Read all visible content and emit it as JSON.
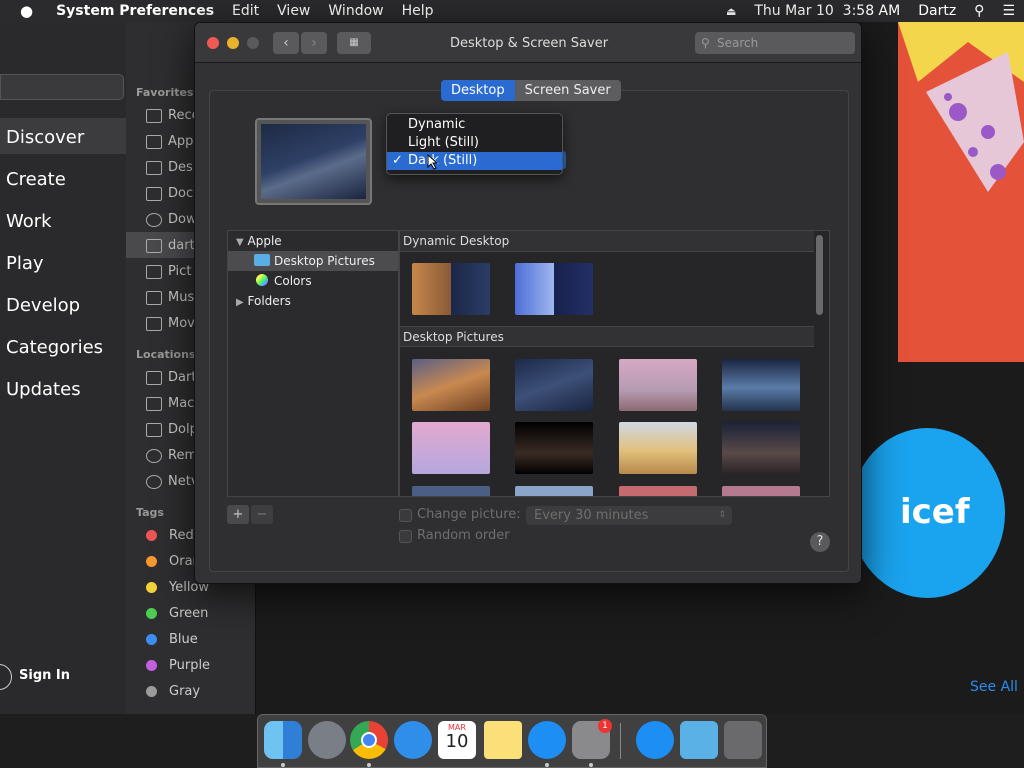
{
  "menubar": {
    "apple": "",
    "app_name": "System Preferences",
    "menus": [
      "Edit",
      "View",
      "Window",
      "Help"
    ],
    "clock": "Thu Mar 10  3:58 AM",
    "user": "Dartz"
  },
  "appstore": {
    "nav": [
      "Discover",
      "Create",
      "Work",
      "Play",
      "Develop",
      "Categories",
      "Updates"
    ],
    "sign_in": "Sign In",
    "see_all": "See All",
    "banner_text": "icef"
  },
  "finder": {
    "favorites_header": "Favorites",
    "favorites": [
      "Rece",
      "App",
      "Des",
      "Doc",
      "Dow",
      "dart",
      "Pict",
      "Mus",
      "Mov"
    ],
    "locations_header": "Locations",
    "locations": [
      "Dart",
      "Mac",
      "Dolp",
      "Rem",
      "Netv"
    ],
    "tags_header": "Tags",
    "tags": [
      {
        "label": "Red",
        "color": "#ee5555"
      },
      {
        "label": "Oran",
        "color": "#f59a2f"
      },
      {
        "label": "Yellow",
        "color": "#f3d33a"
      },
      {
        "label": "Green",
        "color": "#4fcb52"
      },
      {
        "label": "Blue",
        "color": "#3b8ef0"
      },
      {
        "label": "Purple",
        "color": "#c260e0"
      },
      {
        "label": "Gray",
        "color": "#9b9b9b"
      }
    ]
  },
  "window": {
    "title": "Desktop & Screen Saver",
    "search_placeholder": "Search",
    "tabs": [
      "Desktop",
      "Screen Saver"
    ],
    "popup_options": [
      "Dynamic",
      "Light (Still)",
      "Dark (Still)"
    ],
    "popup_selected": "Dark (Still)",
    "source_list": {
      "apple": "Apple",
      "desktop_pictures": "Desktop Pictures",
      "colors": "Colors",
      "folders": "Folders"
    },
    "sections": [
      "Dynamic Desktop",
      "Desktop Pictures"
    ],
    "change_picture_label": "Change picture:",
    "interval": "Every 30 minutes",
    "random_order_label": "Random order",
    "help": "?"
  },
  "dock": {
    "calendar_month": "MAR",
    "calendar_day": "10",
    "badge": "1"
  }
}
